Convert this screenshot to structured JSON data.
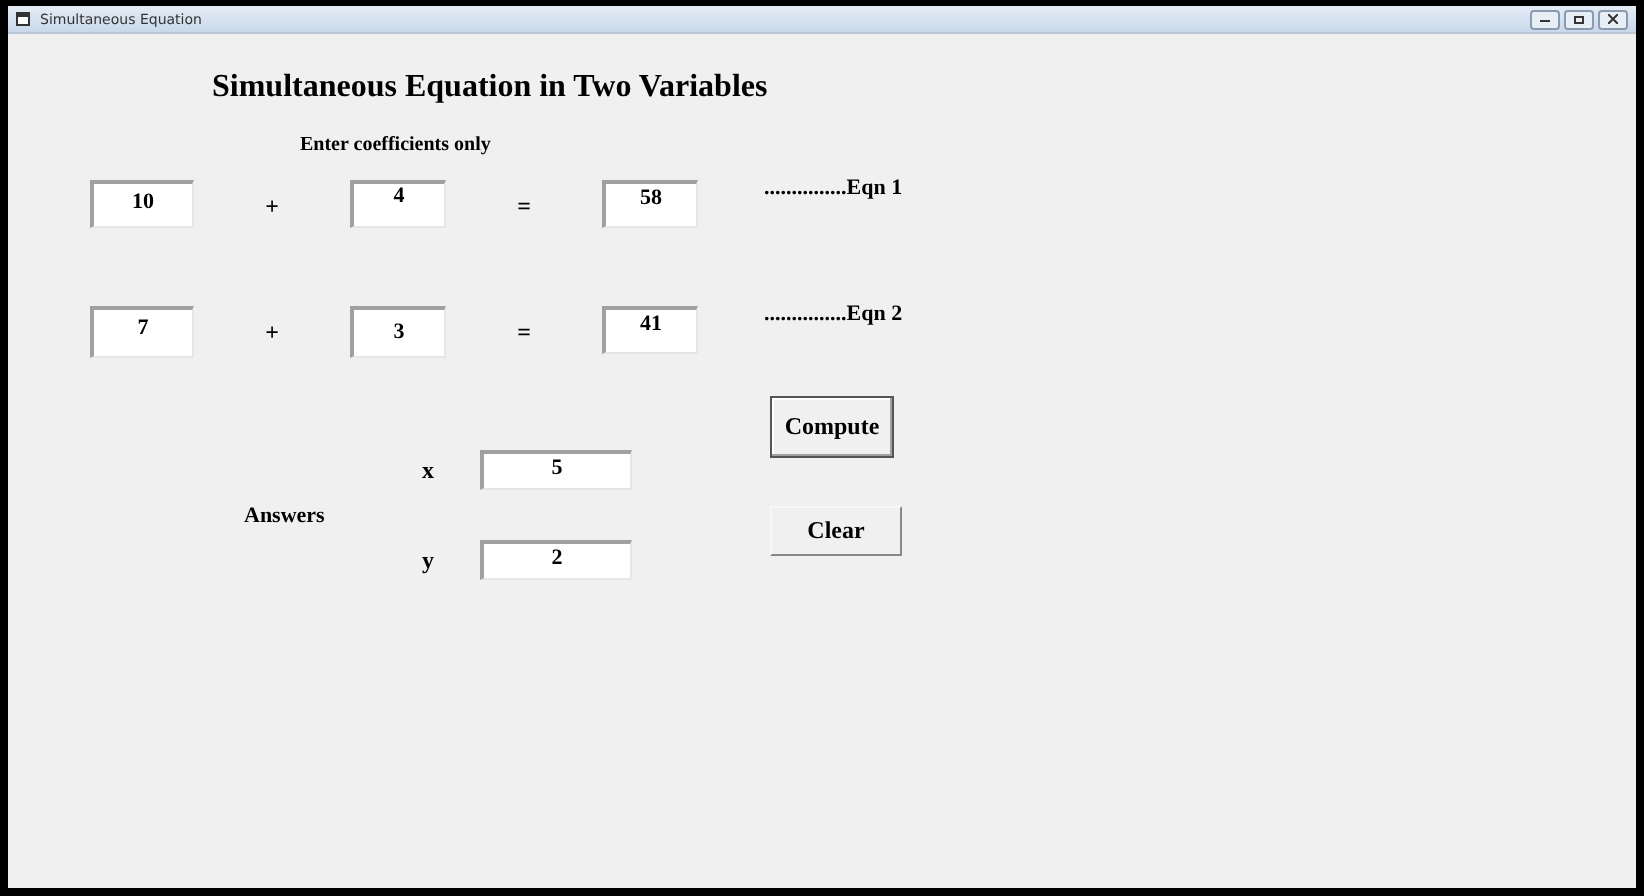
{
  "window": {
    "title": "Simultaneous Equation"
  },
  "heading": "Simultaneous Equation in Two Variables",
  "instruction": "Enter coefficients only",
  "equations": [
    {
      "a": "10",
      "plus": "+",
      "b": "4",
      "equals": "=",
      "c": "58",
      "label": "...............Eqn 1"
    },
    {
      "a": "7",
      "plus": "+",
      "b": "3",
      "equals": "=",
      "c": "41",
      "label": "...............Eqn 2"
    }
  ],
  "answers": {
    "label": "Answers",
    "vars": [
      {
        "name": "x",
        "value": "5"
      },
      {
        "name": "y",
        "value": "2"
      }
    ]
  },
  "buttons": [
    {
      "label": "Compute",
      "kind": "raised"
    },
    {
      "label": "Clear",
      "kind": "flat"
    }
  ]
}
